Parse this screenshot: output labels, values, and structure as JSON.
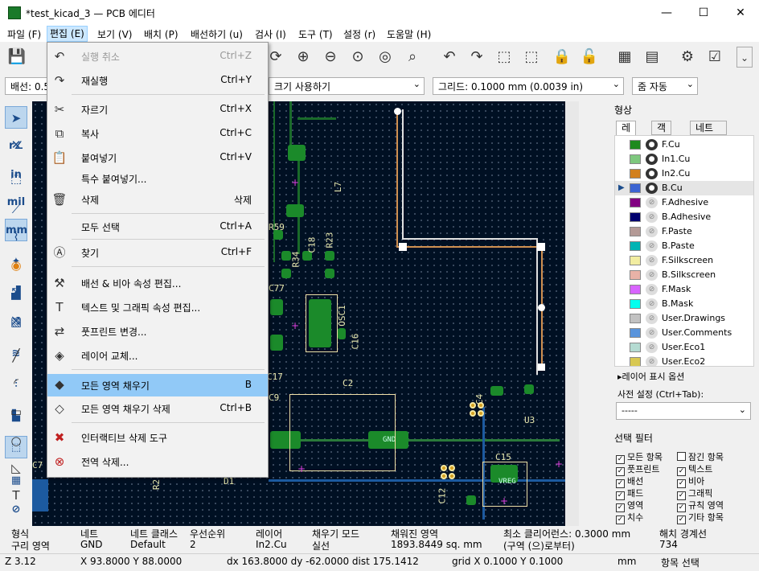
{
  "window": {
    "title": "*test_kicad_3 — PCB 에디터",
    "minimize": "—",
    "maximize": "☐",
    "close": "✕"
  },
  "menubar": [
    {
      "label": "파일 (F)"
    },
    {
      "label": "편집 (E)"
    },
    {
      "label": "보기 (V)"
    },
    {
      "label": "배치 (P)"
    },
    {
      "label": "배선하기 (u)"
    },
    {
      "label": "검사 (I)"
    },
    {
      "label": "도구 (T)"
    },
    {
      "label": "설정 (r)"
    },
    {
      "label": "도움말 (H)"
    }
  ],
  "toolbar2": {
    "track_width": "배선: 0.5",
    "via_size": "크기 사용하기",
    "grid": "그리드: 0.1000 mm (0.0039 in)",
    "zoom": "줌 자동"
  },
  "edit_menu": {
    "items": [
      {
        "icon": "undo-icon",
        "glyph": "↶",
        "label": "실행 취소",
        "shortcut": "Ctrl+Z",
        "disabled": true
      },
      {
        "icon": "redo-icon",
        "glyph": "↷",
        "label": "재실행",
        "shortcut": "Ctrl+Y"
      },
      {
        "icon": "cut-icon",
        "glyph": "✂",
        "label": "자르기",
        "shortcut": "Ctrl+X"
      },
      {
        "icon": "copy-icon",
        "glyph": "⧉",
        "label": "복사",
        "shortcut": "Ctrl+C"
      },
      {
        "icon": "paste-icon",
        "glyph": "📋",
        "label": "붙여넣기",
        "shortcut": "Ctrl+V"
      },
      {
        "icon": "paste-special-icon",
        "glyph": "",
        "label": "특수 붙여넣기...",
        "shortcut": ""
      },
      {
        "icon": "delete-icon",
        "glyph": "🗑",
        "label": "삭제",
        "shortcut": "삭제"
      },
      {
        "icon": "select-all-icon",
        "glyph": "",
        "label": "모두 선택",
        "shortcut": "Ctrl+A"
      },
      {
        "icon": "find-icon",
        "glyph": "Ⓐ",
        "label": "찾기",
        "shortcut": "Ctrl+F"
      },
      {
        "icon": "edit-track-via-icon",
        "glyph": "⚒",
        "label": "배선 & 비아 속성 편집...",
        "shortcut": ""
      },
      {
        "icon": "edit-text-icon",
        "glyph": "T",
        "label": "텍스트 및 그래픽 속성 편집...",
        "shortcut": ""
      },
      {
        "icon": "change-footprint-icon",
        "glyph": "⇄",
        "label": "풋프린트 변경...",
        "shortcut": ""
      },
      {
        "icon": "swap-layers-icon",
        "glyph": "◈",
        "label": "레이어 교체...",
        "shortcut": ""
      },
      {
        "icon": "fill-zones-icon",
        "glyph": "◆",
        "label": "모든 영역 채우기",
        "shortcut": "B",
        "highlight": true
      },
      {
        "icon": "unfill-zones-icon",
        "glyph": "◇",
        "label": "모든 영역 채우기 삭제",
        "shortcut": "Ctrl+B"
      },
      {
        "icon": "interactive-delete-icon",
        "glyph": "✖",
        "label": "인터랙티브 삭제 도구",
        "shortcut": ""
      },
      {
        "icon": "global-delete-icon",
        "glyph": "⊗",
        "label": "전역 삭제...",
        "shortcut": ""
      }
    ]
  },
  "appearance": {
    "title": "형상",
    "tabs": [
      "레이어",
      "객체",
      "네트"
    ],
    "layers": [
      {
        "name": "F.Cu",
        "color": "#1e8a1e",
        "visible": true
      },
      {
        "name": "In1.Cu",
        "color": "#7ec87e",
        "visible": true
      },
      {
        "name": "In2.Cu",
        "color": "#d2801e",
        "visible": true
      },
      {
        "name": "B.Cu",
        "color": "#3c64d2",
        "visible": true,
        "selected": true
      },
      {
        "name": "F.Adhesive",
        "color": "#820082",
        "visible": false
      },
      {
        "name": "B.Adhesive",
        "color": "#00006e",
        "visible": false
      },
      {
        "name": "F.Paste",
        "color": "#b49a96",
        "visible": false
      },
      {
        "name": "B.Paste",
        "color": "#00b4b4",
        "visible": false
      },
      {
        "name": "F.Silkscreen",
        "color": "#f2eda1",
        "visible": false
      },
      {
        "name": "B.Silkscreen",
        "color": "#e8b2a7",
        "visible": false
      },
      {
        "name": "F.Mask",
        "color": "#d864ff",
        "visible": false
      },
      {
        "name": "B.Mask",
        "color": "#02ffee",
        "visible": false
      },
      {
        "name": "User.Drawings",
        "color": "#c2c2c2",
        "visible": false
      },
      {
        "name": "User.Comments",
        "color": "#5994dc",
        "visible": false
      },
      {
        "name": "User.Eco1",
        "color": "#b4dbd2",
        "visible": false
      },
      {
        "name": "User.Eco2",
        "color": "#d8c852",
        "visible": false
      }
    ],
    "layer_display_options": "레이어 표시 옵션",
    "presets_label": "사전 설정 (Ctrl+Tab):",
    "presets_value": "-----"
  },
  "selection_filter": {
    "title": "선택 필터",
    "items": [
      {
        "label": "모든 항목",
        "checked": true
      },
      {
        "label": "잠긴 항목",
        "checked": false
      },
      {
        "label": "풋프린트",
        "checked": true
      },
      {
        "label": "텍스트",
        "checked": true
      },
      {
        "label": "배선",
        "checked": true
      },
      {
        "label": "비아",
        "checked": true
      },
      {
        "label": "패드",
        "checked": true
      },
      {
        "label": "그래픽",
        "checked": true
      },
      {
        "label": "영역",
        "checked": true
      },
      {
        "label": "규칙 영역",
        "checked": true
      },
      {
        "label": "치수",
        "checked": true
      },
      {
        "label": "기타 항목",
        "checked": true
      }
    ]
  },
  "info": {
    "headers": [
      "형식",
      "네트",
      "네트 클래스",
      "우선순위",
      "레이어",
      "채우기 모드",
      "채워진 영역",
      "최소 클리어런스: 0.3000 mm",
      "해치 경계선"
    ],
    "values": [
      "구리 영역",
      "GND",
      "Default",
      "2",
      "In2.Cu",
      "실선",
      "1893.8449 sq. mm",
      "(구역 (으)로부터)",
      "734"
    ]
  },
  "status": {
    "z": "Z 3.12",
    "xy": "X 93.8000  Y 88.0000",
    "delta": "dx 163.8000  dy -62.0000  dist 175.1412",
    "grid": "grid X 0.1000  Y 0.1000",
    "units": "mm",
    "mode": "항목 선택"
  },
  "pcb_labels": [
    "R59",
    "C77",
    "C18",
    "R23",
    "R34",
    "OSC1",
    "C16",
    "C17",
    "C9",
    "C2",
    "GND",
    "C4",
    "U3",
    "C15",
    "VREG",
    "C12",
    "D1",
    "L7",
    "R2",
    "C7"
  ]
}
